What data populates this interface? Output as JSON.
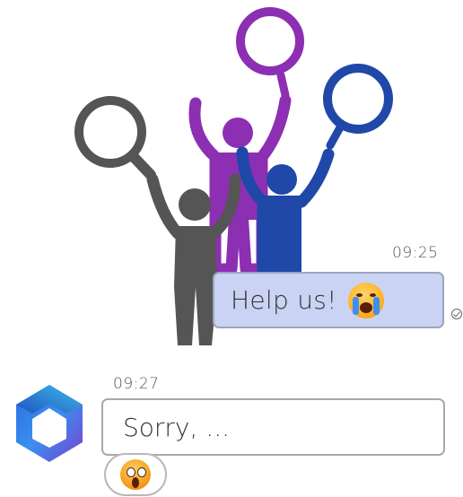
{
  "messages": {
    "sent": {
      "time": "09:25",
      "text": "Help us!",
      "emoji": "loudly-crying-face"
    },
    "received": {
      "time": "09:27",
      "text": "Sorry, ...",
      "reaction": "face-screaming-in-fear"
    }
  },
  "colors": {
    "sent_bubble_bg": "#cad3f3",
    "sent_bubble_border": "#9ea4bc",
    "recv_bubble_border": "#a9a9a9",
    "figure_gray": "#555555",
    "figure_purple": "#8c2fb3",
    "figure_blue": "#1f48a8"
  },
  "icons": {
    "illustration": "people-holding-magnifying-glasses-illustration",
    "avatar": "copilot-logo-icon",
    "read_receipt": "read-check-icon"
  }
}
